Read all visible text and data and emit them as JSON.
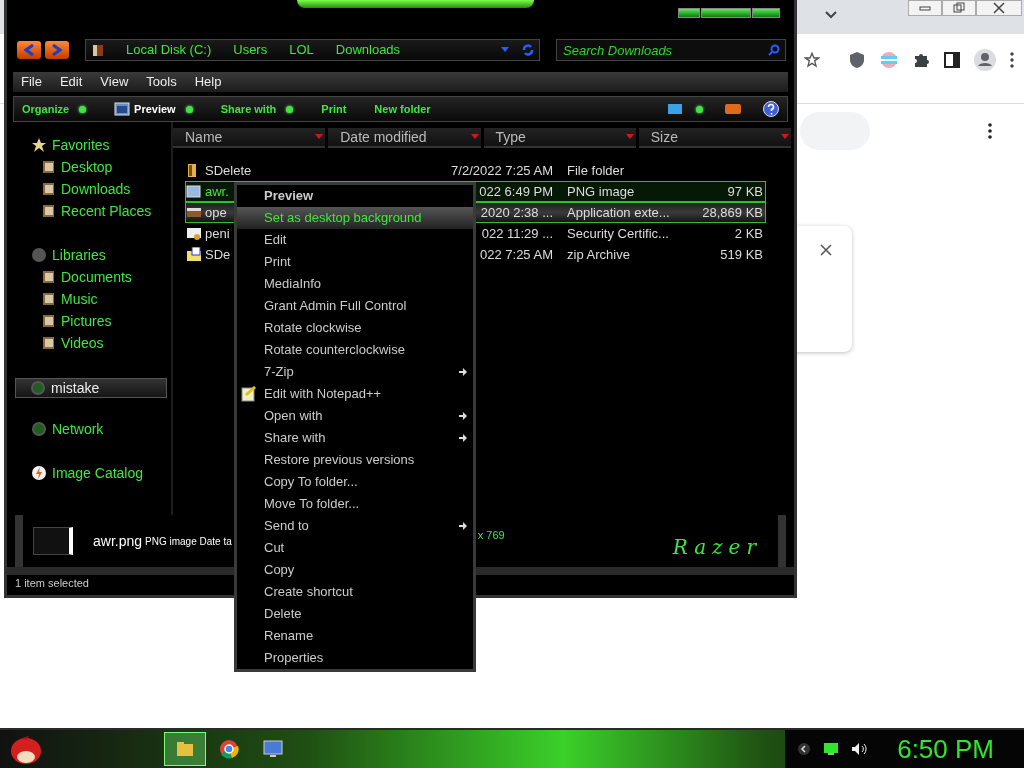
{
  "explorer": {
    "breadcrumbs": [
      "Local Disk (C:)",
      "Users",
      "LOL",
      "Downloads"
    ],
    "search": {
      "placeholder": "Search Downloads"
    },
    "menu_bar": [
      "File",
      "Edit",
      "View",
      "Tools",
      "Help"
    ],
    "toolbar": [
      {
        "label": "Organize",
        "kind": "plain",
        "dropdown": true
      },
      {
        "label": "Preview",
        "kind": "preview",
        "dropdown": true
      },
      {
        "label": "Share with",
        "kind": "plain",
        "dropdown": true
      },
      {
        "label": "Print",
        "kind": "plain",
        "dropdown": false
      },
      {
        "label": "New folder",
        "kind": "plain",
        "dropdown": false
      }
    ],
    "sidebar": [
      {
        "label": "Favorites",
        "selected": false,
        "children": [
          {
            "label": "Desktop",
            "selected": false
          },
          {
            "label": "Downloads",
            "selected": false
          },
          {
            "label": "Recent Places",
            "selected": false
          }
        ]
      },
      {
        "label": "Libraries",
        "selected": false,
        "children": [
          {
            "label": "Documents",
            "selected": false
          },
          {
            "label": "Music",
            "selected": false
          },
          {
            "label": "Pictures",
            "selected": false
          },
          {
            "label": "Videos",
            "selected": false
          }
        ]
      },
      {
        "label": "mistake",
        "selected": true
      },
      {
        "label": "Network",
        "selected": false
      },
      {
        "label": "Image Catalog",
        "selected": false
      }
    ],
    "columns": [
      "Name",
      "Date modified",
      "Type",
      "Size"
    ],
    "files": [
      {
        "kind": "folder",
        "name": "SDelete",
        "date": "7/2/2022 7:25 AM",
        "type": "File folder",
        "selected": false,
        "hovered": false
      },
      {
        "kind": "image",
        "name": "awr.",
        "date": "022 6:49 PM",
        "type": "PNG image",
        "size": "97 KB",
        "selected": true,
        "hovered": false
      },
      {
        "kind": "extension",
        "name": "ope",
        "date": "2020 2:38 ...",
        "type": "Application exte...",
        "size": "28,869 KB",
        "selected": false,
        "hovered": true
      },
      {
        "kind": "certificate",
        "name": "peni",
        "date": "022 11:29 ...",
        "type": "Security Certific...",
        "size": "2 KB",
        "selected": false,
        "hovered": false
      },
      {
        "kind": "archive",
        "name": "SDe",
        "date": "022 7:25 AM",
        "type": "zip Archive",
        "size": "519 KB",
        "selected": false,
        "hovered": false
      }
    ],
    "details": {
      "name": "awr.png",
      "info": "PNG image Date ta",
      "dimensions": "x 769"
    },
    "logo": "Razer",
    "status": "1 item selected"
  },
  "context_menu": [
    {
      "label": "Preview",
      "default": true,
      "highlighted": false,
      "submenu": false,
      "icon": false
    },
    {
      "label": "Set as desktop background",
      "default": false,
      "highlighted": true,
      "submenu": false,
      "icon": false
    },
    {
      "label": "Edit",
      "default": false,
      "highlighted": false,
      "submenu": false,
      "icon": false
    },
    {
      "label": "Print",
      "default": false,
      "highlighted": false,
      "submenu": false,
      "icon": false
    },
    {
      "label": "MediaInfo",
      "default": false,
      "highlighted": false,
      "submenu": false,
      "icon": false
    },
    {
      "label": "Grant Admin Full Control",
      "default": false,
      "highlighted": false,
      "submenu": false,
      "icon": false
    },
    {
      "label": "Rotate clockwise",
      "default": false,
      "highlighted": false,
      "submenu": false,
      "icon": false
    },
    {
      "label": "Rotate counterclockwise",
      "default": false,
      "highlighted": false,
      "submenu": false,
      "icon": false
    },
    {
      "label": "7-Zip",
      "default": false,
      "highlighted": false,
      "submenu": true,
      "icon": false
    },
    {
      "label": "Edit with Notepad++",
      "default": false,
      "highlighted": false,
      "submenu": false,
      "icon": true
    },
    {
      "label": "Open with",
      "default": false,
      "highlighted": false,
      "submenu": true,
      "icon": false
    },
    {
      "label": "Share with",
      "default": false,
      "highlighted": false,
      "submenu": true,
      "icon": false
    },
    {
      "label": "Restore previous versions",
      "default": false,
      "highlighted": false,
      "submenu": false,
      "icon": false
    },
    {
      "label": "Copy To folder...",
      "default": false,
      "highlighted": false,
      "submenu": false,
      "icon": false
    },
    {
      "label": "Move To folder...",
      "default": false,
      "highlighted": false,
      "submenu": false,
      "icon": false
    },
    {
      "label": "Send to",
      "default": false,
      "highlighted": false,
      "submenu": true,
      "icon": false
    },
    {
      "label": "Cut",
      "default": false,
      "highlighted": false,
      "submenu": false,
      "icon": false
    },
    {
      "label": "Copy",
      "default": false,
      "highlighted": false,
      "submenu": false,
      "icon": false
    },
    {
      "label": "Create shortcut",
      "default": false,
      "highlighted": false,
      "submenu": false,
      "icon": false
    },
    {
      "label": "Delete",
      "default": false,
      "highlighted": false,
      "submenu": false,
      "icon": false
    },
    {
      "label": "Rename",
      "default": false,
      "highlighted": false,
      "submenu": false,
      "icon": false
    },
    {
      "label": "Properties",
      "default": false,
      "highlighted": false,
      "submenu": false,
      "icon": false
    }
  ],
  "taskbar": {
    "tasks": [
      {
        "selected": true
      },
      {
        "selected": false
      },
      {
        "selected": false
      }
    ],
    "clock": "6:50 PM"
  }
}
